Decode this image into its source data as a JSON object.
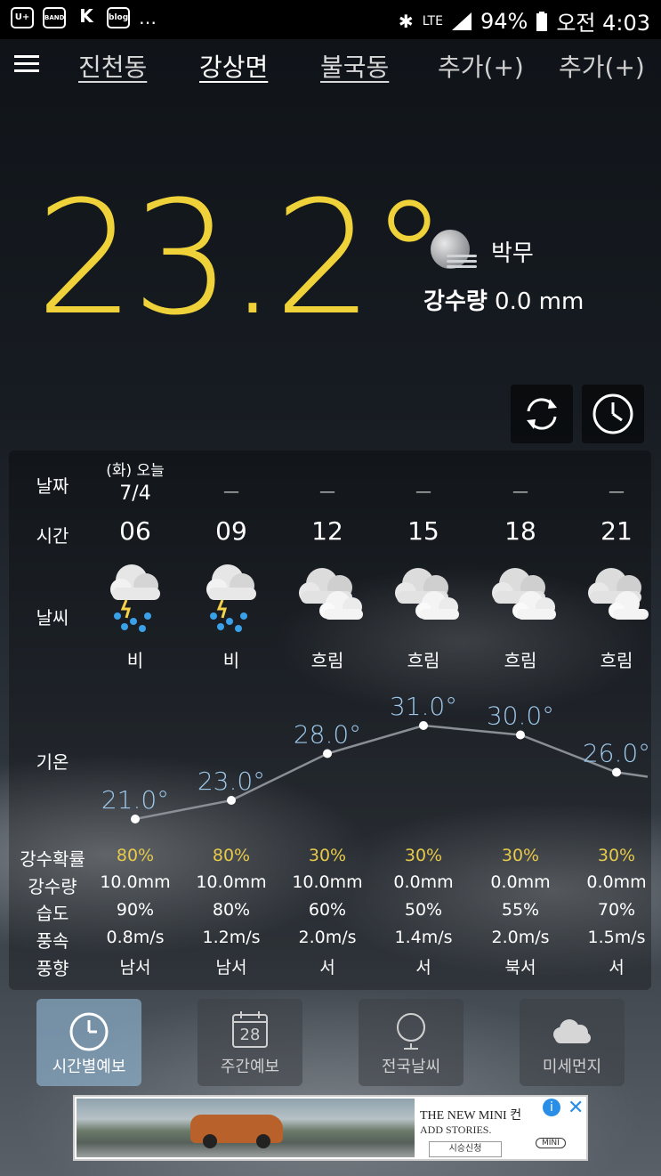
{
  "status_bar": {
    "left_icons": [
      "U+",
      "BAND",
      "K",
      "blog",
      "…"
    ],
    "network": "LTE",
    "battery": "94%",
    "time": "오전 4:03"
  },
  "tabs": [
    {
      "label": "진천동",
      "active": false
    },
    {
      "label": "강상면",
      "active": true
    },
    {
      "label": "불국동",
      "active": false
    },
    {
      "label": "추가(+)",
      "active": false
    },
    {
      "label": "추가(+)",
      "active": false
    }
  ],
  "current": {
    "temperature": "23.2°",
    "condition": "박무",
    "precip_label": "강수량",
    "precip_value": "0.0 mm"
  },
  "row_labels": {
    "date": "날짜",
    "time": "시간",
    "weather": "날씨",
    "temp": "기온",
    "pop": "강수확률",
    "precip": "강수량",
    "humidity": "습도",
    "wind_speed": "풍속",
    "wind_dir": "풍향"
  },
  "forecast": [
    {
      "day": "(화) 오늘",
      "date": "7/4",
      "hour": "06",
      "icon": "rain-icon",
      "weather": "비",
      "temp": 21.0,
      "temp_label": "21.0°",
      "pop": "80%",
      "precip": "10.0mm",
      "humidity": "90%",
      "wind_speed": "0.8m/s",
      "wind_dir": "남서"
    },
    {
      "day": "",
      "date": "—",
      "hour": "09",
      "icon": "rain-icon",
      "weather": "비",
      "temp": 23.0,
      "temp_label": "23.0°",
      "pop": "80%",
      "precip": "10.0mm",
      "humidity": "80%",
      "wind_speed": "1.2m/s",
      "wind_dir": "남서"
    },
    {
      "day": "",
      "date": "—",
      "hour": "12",
      "icon": "cloudy-icon",
      "weather": "흐림",
      "temp": 28.0,
      "temp_label": "28.0°",
      "pop": "30%",
      "precip": "10.0mm",
      "humidity": "60%",
      "wind_speed": "2.0m/s",
      "wind_dir": "서"
    },
    {
      "day": "",
      "date": "—",
      "hour": "15",
      "icon": "cloudy-icon",
      "weather": "흐림",
      "temp": 31.0,
      "temp_label": "31.0°",
      "pop": "30%",
      "precip": "0.0mm",
      "humidity": "50%",
      "wind_speed": "1.4m/s",
      "wind_dir": "서"
    },
    {
      "day": "",
      "date": "—",
      "hour": "18",
      "icon": "cloudy-icon",
      "weather": "흐림",
      "temp": 30.0,
      "temp_label": "30.0°",
      "pop": "30%",
      "precip": "0.0mm",
      "humidity": "55%",
      "wind_speed": "2.0m/s",
      "wind_dir": "북서"
    },
    {
      "day": "",
      "date": "—",
      "hour": "21",
      "icon": "cloudy-icon",
      "weather": "흐림",
      "temp": 26.0,
      "temp_label": "26.0°",
      "pop": "30%",
      "precip": "0.0mm",
      "humidity": "70%",
      "wind_speed": "1.5m/s",
      "wind_dir": "서"
    }
  ],
  "bottom_nav": [
    {
      "label": "시간별예보",
      "icon": "clock-icon",
      "active": true
    },
    {
      "label": "주간예보",
      "icon": "calendar-icon",
      "active": false,
      "badge": "28"
    },
    {
      "label": "전국날씨",
      "icon": "globe-icon",
      "active": false
    },
    {
      "label": "미세먼지",
      "icon": "cloud-icon",
      "active": false
    }
  ],
  "ad": {
    "line1": "THE NEW MINI 컨",
    "line2": "ADD STORIES.",
    "button": "시승신청",
    "brand": "MINI"
  },
  "colors": {
    "temp_yellow": "#efd23a",
    "pop_yellow": "#e8c94a",
    "temp_blue": "#9ec8ea",
    "nav_active": "#96bedc"
  }
}
